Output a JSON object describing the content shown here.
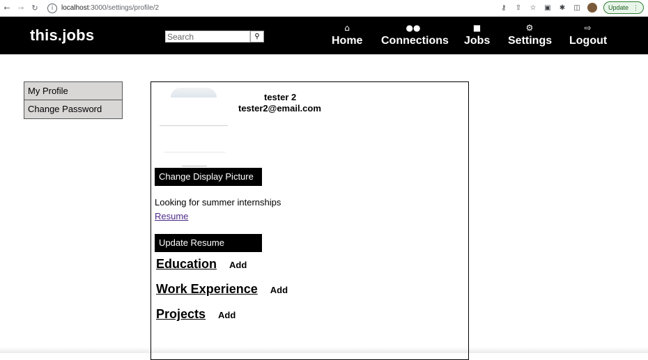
{
  "browser": {
    "back_icon": "arrow-left-icon",
    "forward_icon": "arrow-right-icon",
    "reload_icon": "reload-icon",
    "url_host": "localhost",
    "url_path": ":3000/settings/profile/2",
    "update_label": "Update"
  },
  "header": {
    "brand": "this.jobs",
    "search_placeholder": "Search",
    "nav": [
      {
        "label": "Home",
        "icon": "home-icon"
      },
      {
        "label": "Connections",
        "icon": "people-icon"
      },
      {
        "label": "Jobs",
        "icon": "briefcase-icon"
      },
      {
        "label": "Settings",
        "icon": "gear-icon"
      },
      {
        "label": "Logout",
        "icon": "logout-icon"
      }
    ],
    "background": "#000000",
    "text_color": "#ffffff"
  },
  "sidebar": {
    "items": [
      {
        "label": "My Profile"
      },
      {
        "label": "Change Password"
      }
    ],
    "item_background": "#d9d6d6"
  },
  "profile": {
    "name": "tester 2",
    "email": "tester2@email.com",
    "change_picture_label": "Change Display Picture",
    "bio": "Looking for summer internships",
    "resume_link": "Resume",
    "update_resume_label": "Update Resume",
    "sections": [
      {
        "title": "Education",
        "add_label": "Add"
      },
      {
        "title": "Work Experience",
        "add_label": "Add"
      },
      {
        "title": "Projects",
        "add_label": "Add"
      }
    ]
  }
}
